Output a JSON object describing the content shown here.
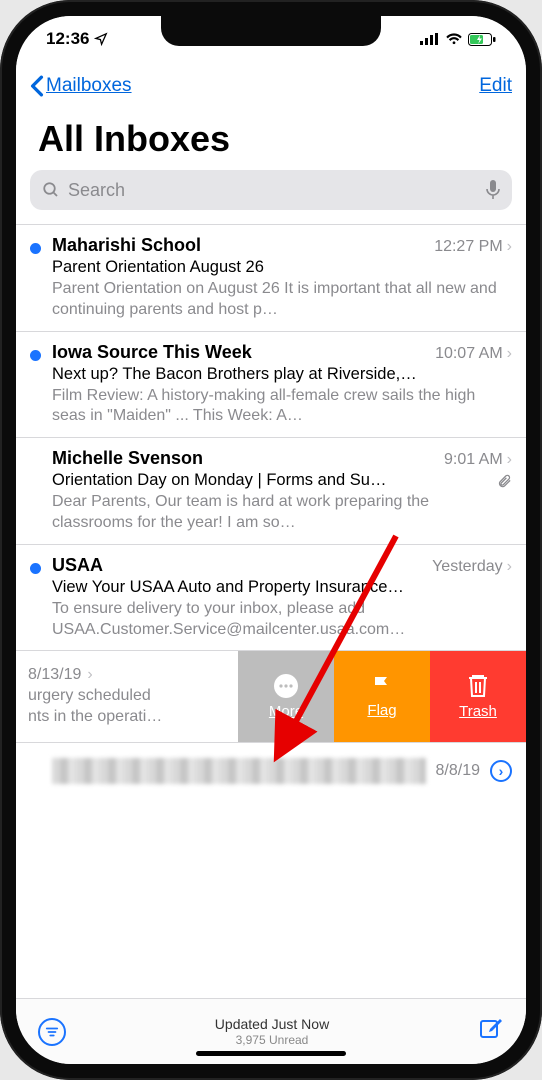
{
  "status": {
    "time": "12:36"
  },
  "nav": {
    "back": "Mailboxes",
    "edit": "Edit"
  },
  "title": "All Inboxes",
  "search": {
    "placeholder": "Search"
  },
  "emails": [
    {
      "unread": true,
      "sender": "Maharishi School",
      "time": "12:27 PM",
      "subject": "Parent Orientation August 26",
      "preview": "Parent Orientation on August 26 It is important that all new and continuing parents and host p…",
      "attachment": false
    },
    {
      "unread": true,
      "sender": "Iowa Source This Week",
      "time": "10:07 AM",
      "subject": "Next up? The Bacon Brothers play at Riverside,…",
      "preview": "Film Review: A history-making all-female crew sails the high seas in \"Maiden\" ... This Week: A…",
      "attachment": false
    },
    {
      "unread": false,
      "sender": "Michelle Svenson",
      "time": "9:01 AM",
      "subject": "Orientation Day on Monday | Forms and Su…",
      "preview": "Dear Parents, Our team is hard at work preparing the classrooms for the year! I am so…",
      "attachment": true
    },
    {
      "unread": true,
      "sender": "USAA",
      "time": "Yesterday",
      "subject": "View Your USAA Auto and Property Insurance…",
      "preview": "To ensure delivery to your inbox, please add USAA.Customer.Service@mailcenter.usaa.com…",
      "attachment": false
    }
  ],
  "swiped": {
    "date": "8/13/19",
    "preview_line1": "urgery scheduled",
    "preview_line2": "nts in the operati…",
    "actions": {
      "more": "More",
      "flag": "Flag",
      "trash": "Trash"
    }
  },
  "blurred_row": {
    "time": "8/8/19"
  },
  "toolbar": {
    "status_line1": "Updated Just Now",
    "status_line2": "3,975 Unread"
  }
}
